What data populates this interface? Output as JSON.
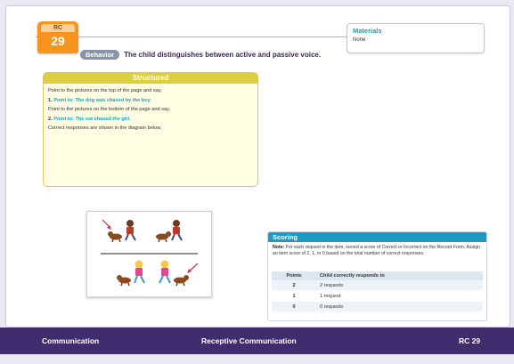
{
  "badge": {
    "top": "RC",
    "number": "29"
  },
  "behavior": {
    "pill": "Behavior",
    "text": "The child distinguishes between active and passive voice."
  },
  "materials": {
    "title": "Materials",
    "value": "None"
  },
  "structured": {
    "title": "Structured",
    "line1": "Point to the pictures on the top of the page and say,",
    "item1_num": "1.",
    "item1_text": "Point to: The dog was chased by the boy.",
    "line2": "Point to the pictures on the bottom of the page and say,",
    "item2_num": "2.",
    "item2_text": "Point to: The cat chased the girl.",
    "line3": "Correct responses are shown in the diagram below."
  },
  "scoring": {
    "title": "Scoring",
    "note_label": "Note:",
    "note_text": "For each request in the item, record a score of Correct or Incorrect on the Record Form. Assign an item score of 2, 1, or 0 based on the total number of correct responses.",
    "columns": [
      "Points",
      "Child correctly responds to"
    ],
    "rows": [
      {
        "points": "2",
        "desc": "2 requests"
      },
      {
        "points": "1",
        "desc": "1 request"
      },
      {
        "points": "0",
        "desc": "0 requests"
      }
    ]
  },
  "footer": {
    "left": "Communication",
    "center": "Receptive Communication",
    "right": "RC 29"
  },
  "colors": {
    "footer_bg": "#3f2d6e",
    "badge_orange": "#f7941d",
    "structured_header": "#dccf3f",
    "scoring_header": "#1c9ac0",
    "cue_text": "#18a5c0",
    "arrow": "#e0245e"
  }
}
